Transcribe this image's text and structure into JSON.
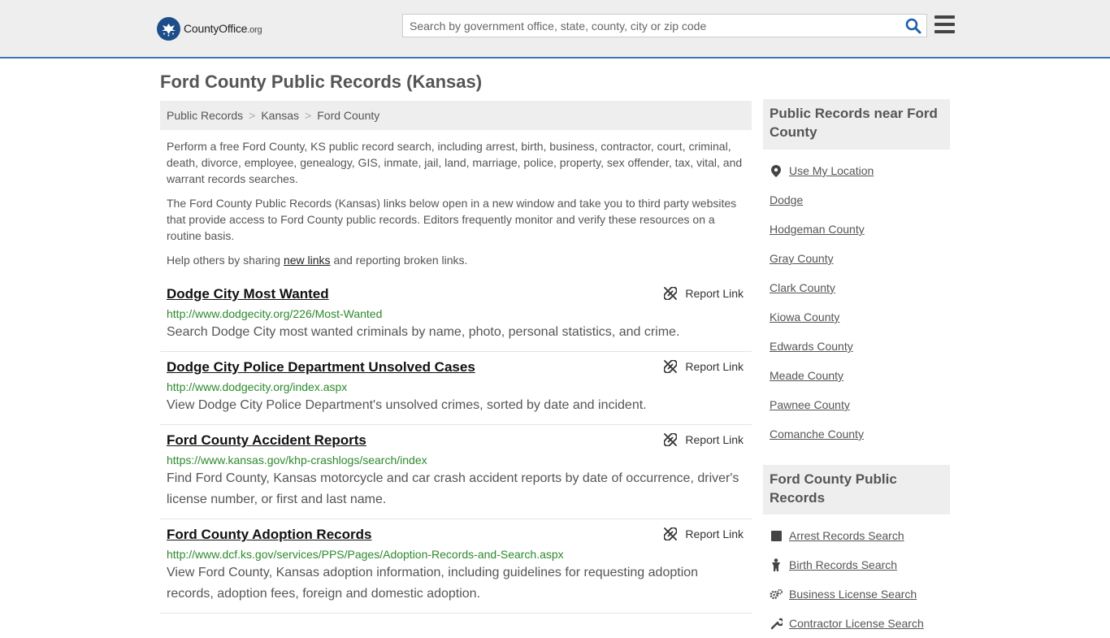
{
  "header": {
    "logo_brand": "CountyOffice",
    "logo_tld": ".org",
    "search_placeholder": "Search by government office, state, county, city or zip code"
  },
  "page": {
    "title": "Ford County Public Records (Kansas)"
  },
  "breadcrumb": [
    "Public Records",
    "Kansas",
    "Ford County"
  ],
  "intro": {
    "p1": "Perform a free Ford County, KS public record search, including arrest, birth, business, contractor, court, criminal, death, divorce, employee, genealogy, GIS, inmate, jail, land, marriage, police, property, sex offender, tax, vital, and warrant records searches.",
    "p2": "The Ford County Public Records (Kansas) links below open in a new window and take you to third party websites that provide access to Ford County public records. Editors frequently monitor and verify these resources on a routine basis.",
    "p3_before": "Help others by sharing ",
    "p3_link": "new links",
    "p3_after": " and reporting broken links."
  },
  "report_label": "Report Link",
  "results": [
    {
      "title": "Dodge City Most Wanted",
      "url": "http://www.dodgecity.org/226/Most-Wanted",
      "desc": "Search Dodge City most wanted criminals by name, photo, personal statistics, and crime."
    },
    {
      "title": "Dodge City Police Department Unsolved Cases",
      "url": "http://www.dodgecity.org/index.aspx",
      "desc": "View Dodge City Police Department's unsolved crimes, sorted by date and incident."
    },
    {
      "title": "Ford County Accident Reports",
      "url": "https://www.kansas.gov/khp-crashlogs/search/index",
      "desc": "Find Ford County, Kansas motorcycle and car crash accident reports by date of occurrence, driver's license number, or first and last name."
    },
    {
      "title": "Ford County Adoption Records",
      "url": "http://www.dcf.ks.gov/services/PPS/Pages/Adoption-Records-and-Search.aspx",
      "desc": "View Ford County, Kansas adoption information, including guidelines for requesting adoption records, adoption fees, foreign and domestic adoption."
    }
  ],
  "sidebar": {
    "near_title": "Public Records near Ford County",
    "near_items": [
      {
        "label": "Use My Location",
        "icon": "map-marker-icon"
      },
      {
        "label": "Dodge"
      },
      {
        "label": "Hodgeman County"
      },
      {
        "label": "Gray County"
      },
      {
        "label": "Clark County"
      },
      {
        "label": "Kiowa County"
      },
      {
        "label": "Edwards County"
      },
      {
        "label": "Meade County"
      },
      {
        "label": "Pawnee County"
      },
      {
        "label": "Comanche County"
      }
    ],
    "records_title": "Ford County Public Records",
    "records_items": [
      {
        "label": "Arrest Records Search",
        "icon": "square-icon"
      },
      {
        "label": "Birth Records Search",
        "icon": "baby-icon"
      },
      {
        "label": "Business License Search",
        "icon": "gears-icon"
      },
      {
        "label": "Contractor License Search",
        "icon": "tools-icon"
      }
    ]
  },
  "colors": {
    "accent": "#3a78b5",
    "url_green": "#2c8a2c",
    "header_bg": "#eeeeee",
    "logo_blue": "#1d4e89"
  }
}
